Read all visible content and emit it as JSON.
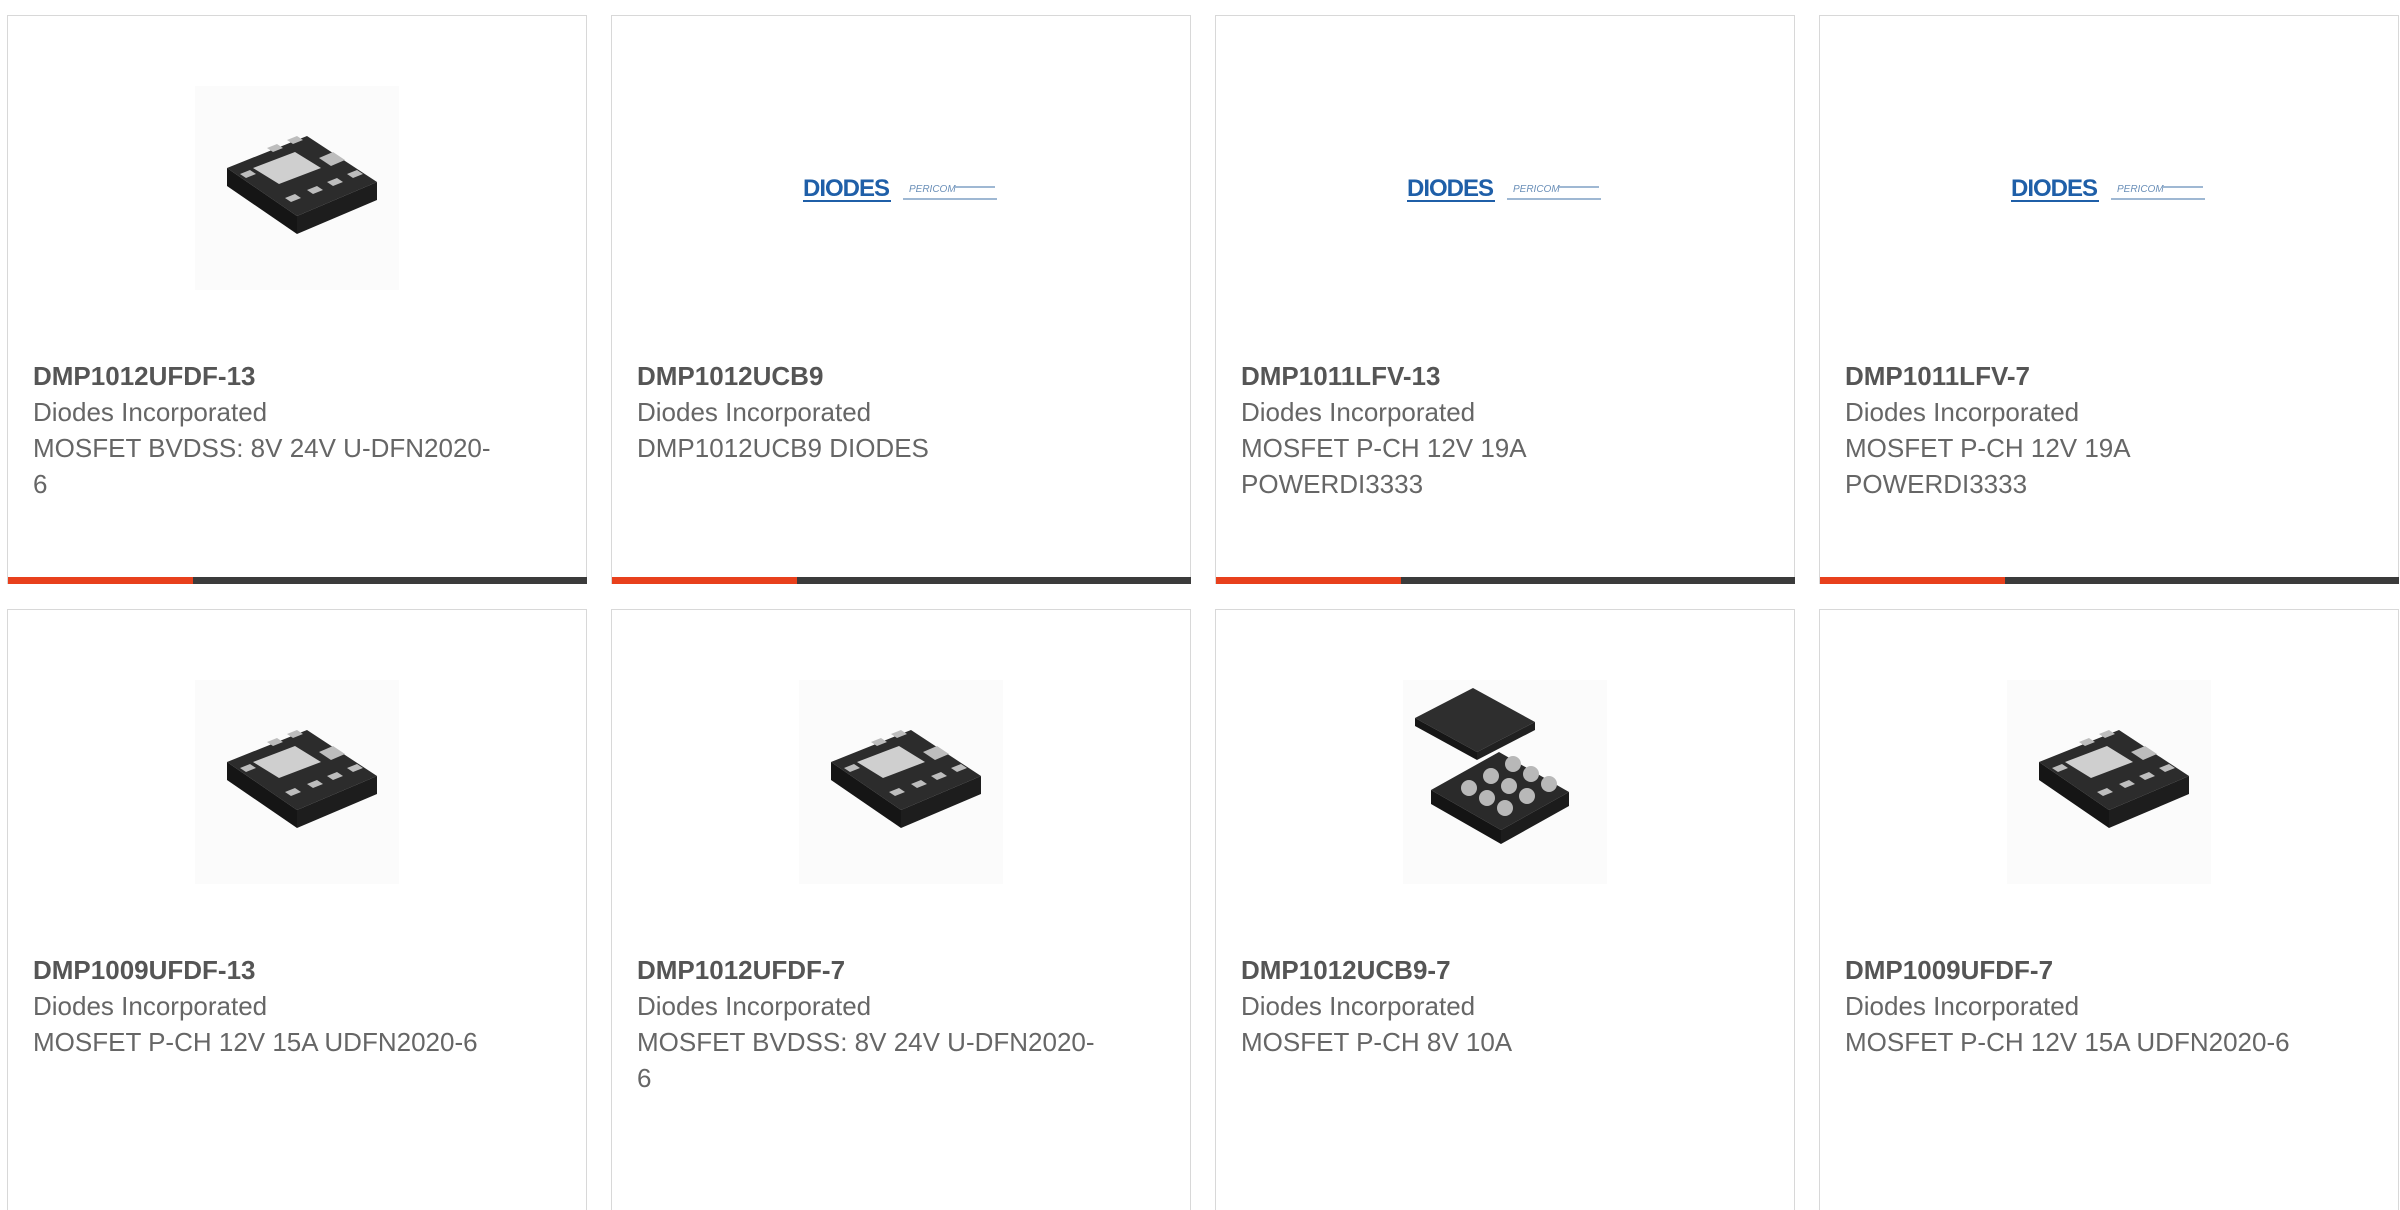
{
  "colors": {
    "accent": "#e8401c",
    "bar": "#3b3b3b",
    "border": "#d8d8d8",
    "title": "#555555",
    "text": "#666666",
    "diodes_blue": "#1f5fa8"
  },
  "products": [
    {
      "part": "DMP1012UFDF-13",
      "maker": "Diodes Incorporated",
      "desc": "MOSFET BVDSS: 8V 24V U-DFN2020-6",
      "image": "dfn-chip-icon",
      "progress": 0.32
    },
    {
      "part": "DMP1012UCB9",
      "maker": "Diodes Incorporated",
      "desc": "DMP1012UCB9 DIODES",
      "image": "diodes-logo",
      "progress": 0.32
    },
    {
      "part": "DMP1011LFV-13",
      "maker": "Diodes Incorporated",
      "desc": "MOSFET P-CH 12V 19A POWERDI3333",
      "image": "diodes-logo",
      "progress": 0.32
    },
    {
      "part": "DMP1011LFV-7",
      "maker": "Diodes Incorporated",
      "desc": "MOSFET P-CH 12V 19A POWERDI3333",
      "image": "diodes-logo",
      "progress": 0.32
    },
    {
      "part": "DMP1009UFDF-13",
      "maker": "Diodes Incorporated",
      "desc": "MOSFET P-CH 12V 15A UDFN2020-6",
      "image": "dfn-chip-icon"
    },
    {
      "part": "DMP1012UFDF-7",
      "maker": "Diodes Incorporated",
      "desc": "MOSFET BVDSS: 8V 24V U-DFN2020-6",
      "image": "dfn-chip-icon"
    },
    {
      "part": "DMP1012UCB9-7",
      "maker": "Diodes Incorporated",
      "desc": "MOSFET P-CH 8V 10A",
      "image": "bga-chip-icon"
    },
    {
      "part": "DMP1009UFDF-7",
      "maker": "Diodes Incorporated",
      "desc": "MOSFET P-CH 12V 15A UDFN2020-6",
      "image": "dfn-chip-icon"
    }
  ]
}
